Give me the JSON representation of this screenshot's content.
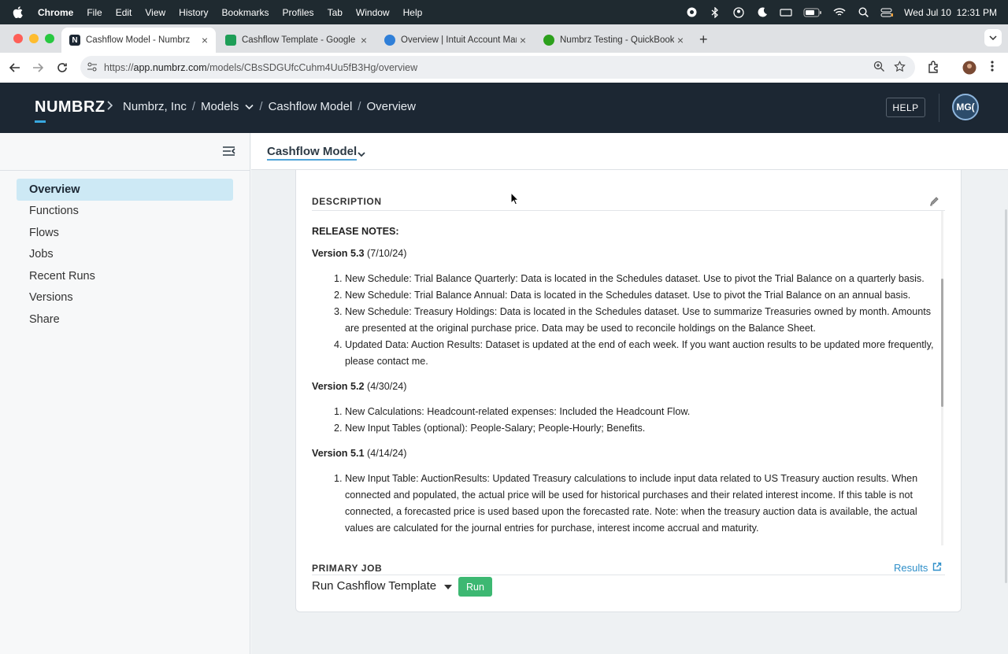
{
  "menubar": {
    "app": "Chrome",
    "items": [
      "File",
      "Edit",
      "View",
      "History",
      "Bookmarks",
      "Profiles",
      "Tab",
      "Window",
      "Help"
    ],
    "clock": "Wed Jul 10  12:31 PM"
  },
  "tabs": [
    {
      "title": "Cashflow Model - Numbrz",
      "favicon": "numbrz-icon",
      "color": "#1c2733"
    },
    {
      "title": "Cashflow Template - Google S",
      "favicon": "sheets-icon",
      "color": "#1e9e57"
    },
    {
      "title": "Overview | Intuit Account Man",
      "favicon": "intuit-icon",
      "color": "#2f7fd8"
    },
    {
      "title": "Numbrz Testing - QuickBooks",
      "favicon": "quickbooks-icon",
      "color": "#2ca01c"
    }
  ],
  "address": {
    "prefix": "https://",
    "host": "app.numbrz.com",
    "path": "/models/CBsSDGUfcCuhm4Uu5fB3Hg/overview"
  },
  "header": {
    "logo": "NUMBRZ",
    "crumbs": {
      "org": "Numbrz, Inc",
      "section": "Models",
      "model": "Cashflow Model",
      "page": "Overview"
    },
    "help": "HELP",
    "avatar": "MG("
  },
  "sidebar": {
    "items": [
      {
        "label": "Overview",
        "active": true
      },
      {
        "label": "Functions"
      },
      {
        "label": "Flows"
      },
      {
        "label": "Jobs"
      },
      {
        "label": "Recent Runs"
      },
      {
        "label": "Versions"
      },
      {
        "label": "Share"
      }
    ]
  },
  "main": {
    "model_title": "Cashflow Model",
    "description_label": "DESCRIPTION",
    "release_notes": "RELEASE NOTES:",
    "versions": [
      {
        "version": "Version 5.3",
        "date": "(7/10/24)",
        "items": [
          "New Schedule: Trial Balance Quarterly: Data is located in the Schedules dataset. Use to pivot the Trial Balance on a quarterly basis.",
          "New Schedule: Trial Balance Annual: Data is located in the Schedules dataset. Use to pivot the Trial Balance on an annual basis.",
          "New Schedule: Treasury Holdings: Data is located in the Schedules dataset. Use to summarize Treasuries owned by month. Amounts are presented at the original purchase price. Data may be used to reconcile holdings on the Balance Sheet.",
          "Updated Data: Auction Results: Dataset is updated at the end of each week. If you want auction results to be updated more frequently, please contact me."
        ]
      },
      {
        "version": "Version 5.2",
        "date": "(4/30/24)",
        "items": [
          "New Calculations: Headcount-related expenses: Included the Headcount Flow.",
          "New Input Tables (optional): People-Salary; People-Hourly; Benefits."
        ]
      },
      {
        "version": "Version 5.1",
        "date": "(4/14/24)",
        "items": [
          "New Input Table: AuctionResults: Updated Treasury calculations to include input data related to US Treasury auction results. When connected and populated, the actual price will be used for historical purchases and their related interest income. If this table is not connected, a forecasted price is used based upon the forecasted rate. Note: when the treasury auction data is available, the actual values are calculated for the journal entries for purchase, interest income accrual and maturity."
        ]
      }
    ],
    "primary_job_label": "PRIMARY JOB",
    "results_link": "Results",
    "job_name": "Run Cashflow Template",
    "run_label": "Run"
  }
}
